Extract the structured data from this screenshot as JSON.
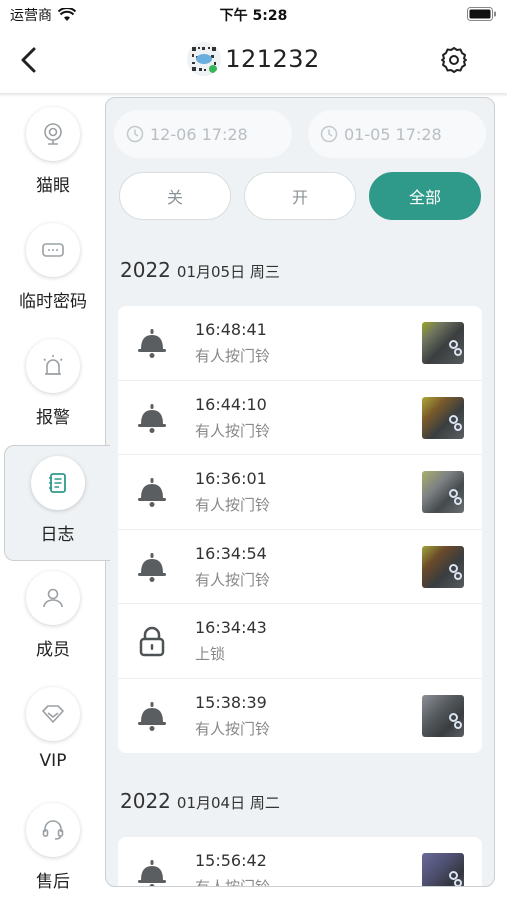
{
  "status_bar": {
    "carrier": "运营商",
    "time": "下午 5:28"
  },
  "nav": {
    "title": "121232"
  },
  "sidebar": [
    {
      "label": "猫眼",
      "icon": "camera-icon"
    },
    {
      "label": "临时密码",
      "icon": "password-icon"
    },
    {
      "label": "报警",
      "icon": "alarm-icon"
    },
    {
      "label": "日志",
      "icon": "log-icon"
    },
    {
      "label": "成员",
      "icon": "member-icon"
    },
    {
      "label": "VIP",
      "icon": "diamond-icon"
    },
    {
      "label": "售后",
      "icon": "headset-icon"
    }
  ],
  "filter": {
    "start_date": "12-06 17:28",
    "end_date": "01-05 17:28",
    "seg_off": "关",
    "seg_on": "开",
    "seg_all": "全部"
  },
  "days": [
    {
      "year": "2022",
      "date": "01月05日 周三",
      "entries": [
        {
          "time": "16:48:41",
          "desc": "有人按门铃",
          "icon": "doorbell-icon"
        },
        {
          "time": "16:44:10",
          "desc": "有人按门铃",
          "icon": "doorbell-icon"
        },
        {
          "time": "16:36:01",
          "desc": "有人按门铃",
          "icon": "doorbell-icon"
        },
        {
          "time": "16:34:54",
          "desc": "有人按门铃",
          "icon": "doorbell-icon"
        },
        {
          "time": "16:34:43",
          "desc": "上锁",
          "icon": "lock-icon"
        },
        {
          "time": "15:38:39",
          "desc": "有人按门铃",
          "icon": "doorbell-icon"
        }
      ]
    },
    {
      "year": "2022",
      "date": "01月04日 周二",
      "entries": [
        {
          "time": "15:56:42",
          "desc": "有人按门铃",
          "icon": "doorbell-icon"
        }
      ]
    }
  ],
  "colors": {
    "accent": "#2f9a8a",
    "panel_bg": "#eef2f4"
  }
}
